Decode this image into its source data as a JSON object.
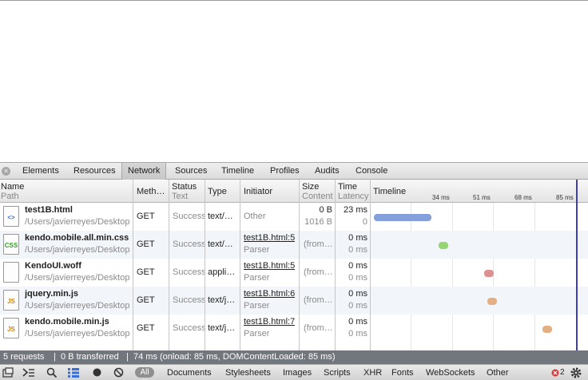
{
  "tabs": [
    {
      "label": "Elements"
    },
    {
      "label": "Resources"
    },
    {
      "label": "Network"
    },
    {
      "label": "Sources"
    },
    {
      "label": "Timeline"
    },
    {
      "label": "Profiles"
    },
    {
      "label": "Audits"
    },
    {
      "label": "Console"
    }
  ],
  "columns": {
    "name": "Name",
    "name_sub": "Path",
    "method": "Meth…",
    "status": "Status",
    "status_sub": "Text",
    "type": "Type",
    "initiator": "Initiator",
    "size": "Size",
    "size_sub": "Content",
    "time": "Time",
    "time_sub": "Latency",
    "timeline": "Timeline"
  },
  "timeline_ticks": [
    "34 ms",
    "51 ms",
    "68 ms",
    "85 ms"
  ],
  "rows": [
    {
      "name": "test1B.html",
      "path": "/Users/javierreyes/Desktop",
      "icon": "<>",
      "method": "GET",
      "status": "Success",
      "type": "text/…",
      "initiator": "Other",
      "initiator_sub": "",
      "size": "0 B",
      "size_sub": "1016 B",
      "time": "23 ms",
      "time_sub": "0",
      "bar": {
        "start": 0,
        "end": 0.27,
        "color": "#8aa7e8"
      }
    },
    {
      "name": "kendo.mobile.all.min.css",
      "path": "/Users/javierreyes/Desktop",
      "icon": "CSS",
      "method": "GET",
      "status": "Success",
      "type": "text/…",
      "initiator": "test1B.html:5",
      "initiator_sub": "Parser",
      "size": "(from…",
      "size_sub": "",
      "time": "0 ms",
      "time_sub": "0 ms",
      "bar": {
        "start": 0.31,
        "end": 0.31,
        "color": "#9ee07a"
      }
    },
    {
      "name": "KendoUI.woff",
      "path": "/Users/javierreyes/Desktop",
      "icon": "",
      "method": "GET",
      "status": "Success",
      "type": "appli…",
      "initiator": "test1B.html:5",
      "initiator_sub": "Parser",
      "size": "(from…",
      "size_sub": "",
      "time": "0 ms",
      "time_sub": "0 ms",
      "bar": {
        "start": 0.53,
        "end": 0.53,
        "color": "#e89898"
      }
    },
    {
      "name": "jquery.min.js",
      "path": "/Users/javierreyes/Desktop",
      "icon": "JS",
      "method": "GET",
      "status": "Success",
      "type": "text/j…",
      "initiator": "test1B.html:6",
      "initiator_sub": "Parser",
      "size": "(from…",
      "size_sub": "",
      "time": "0 ms",
      "time_sub": "0 ms",
      "bar": {
        "start": 0.545,
        "end": 0.545,
        "color": "#f0b98a"
      }
    },
    {
      "name": "kendo.mobile.min.js",
      "path": "/Users/javierreyes/Desktop",
      "icon": "JS",
      "method": "GET",
      "status": "Success",
      "type": "text/j…",
      "initiator": "test1B.html:7",
      "initiator_sub": "Parser",
      "size": "(from…",
      "size_sub": "",
      "time": "0 ms",
      "time_sub": "0 ms",
      "bar": {
        "start": 0.81,
        "end": 0.81,
        "color": "#f0b98a"
      }
    }
  ],
  "status": {
    "requests": "5 requests",
    "transferred": "0 B transferred",
    "timing": "74 ms (onload: 85 ms, DOMContentLoaded: 85 ms)"
  },
  "filters": [
    "All",
    "Documents",
    "Stylesheets",
    "Images",
    "Scripts",
    "XHR",
    "Fonts",
    "WebSockets",
    "Other"
  ],
  "error_count": "2"
}
